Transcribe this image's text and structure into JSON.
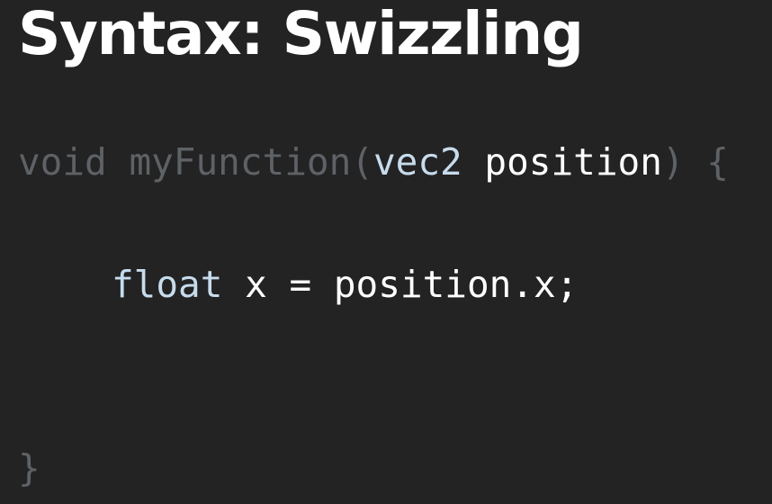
{
  "slide": {
    "title": "Syntax: Swizzling"
  },
  "code": {
    "line1": {
      "keyword": "void",
      "space1": " ",
      "function_name": "myFunction",
      "open_paren": "(",
      "param_type": "vec2",
      "space2": " ",
      "param_name": "position",
      "close_paren": ")",
      "space3": " ",
      "open_brace": "{"
    },
    "line2": {
      "type": "float",
      "space1": " ",
      "variable": "x",
      "assign": " = ",
      "expression": "position.x;"
    },
    "line3": {
      "close_brace": "}"
    }
  },
  "colors": {
    "background": "#232323",
    "title": "#ffffff",
    "dimmed_code": "#5e6266",
    "type_keyword": "#c6dced",
    "code_text": "#ffffff"
  }
}
